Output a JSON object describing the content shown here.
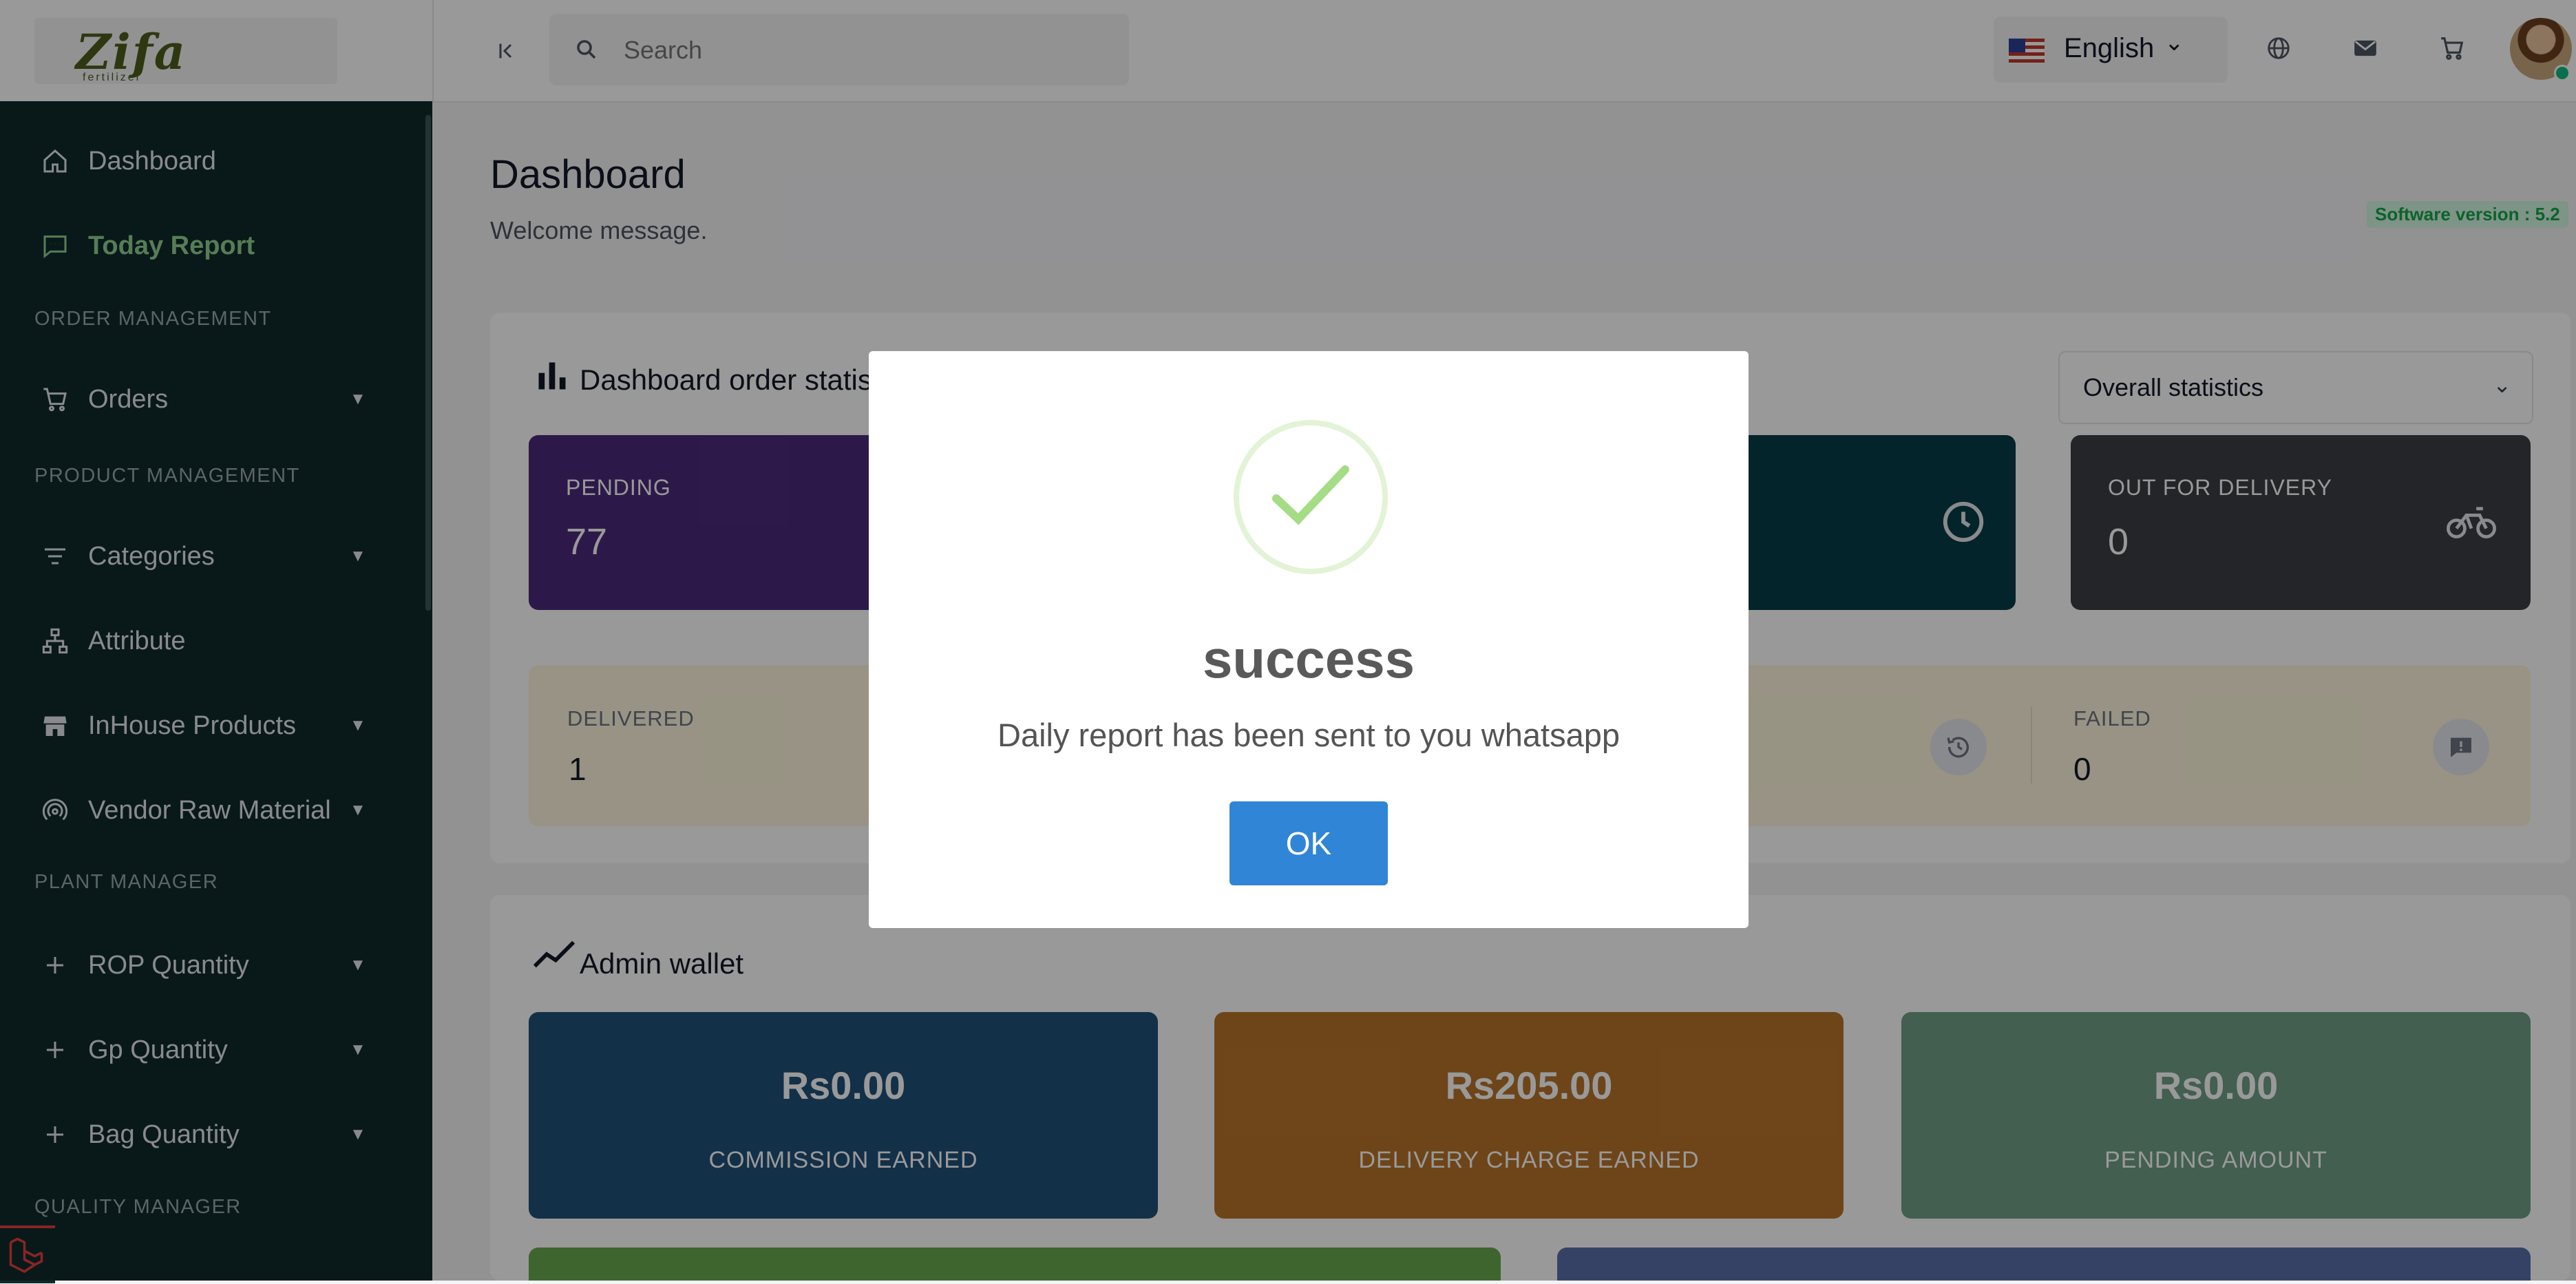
{
  "header": {
    "logo_text": "Zifa",
    "logo_sub": "fertilizer",
    "search_placeholder": "Search",
    "language": "English"
  },
  "sidebar": {
    "items": [
      {
        "label": "Dashboard"
      },
      {
        "label": "Today Report"
      }
    ],
    "sections": {
      "order": "ORDER MANAGEMENT",
      "product": "PRODUCT MANAGEMENT",
      "plant": "PLANT MANAGER",
      "quality": "QUALITY MANAGER"
    },
    "order_items": [
      {
        "label": "Orders"
      }
    ],
    "product_items": [
      {
        "label": "Categories"
      },
      {
        "label": "Attribute"
      },
      {
        "label": "InHouse Products"
      },
      {
        "label": "Vendor Raw Material"
      }
    ],
    "plant_items": [
      {
        "label": "ROP Quantity"
      },
      {
        "label": "Gp Quantity"
      },
      {
        "label": "Bag Quantity"
      }
    ]
  },
  "main": {
    "title": "Dashboard",
    "subtitle": "Welcome message.",
    "version": "Software version : 5.2",
    "order_stats": {
      "title": "Dashboard order statistics",
      "filter": "Overall statistics",
      "pending": {
        "label": "PENDING",
        "value": "77"
      },
      "out_for_delivery": {
        "label": "OUT FOR DELIVERY",
        "value": "0"
      },
      "delivered": {
        "label": "DELIVERED",
        "value": "1"
      },
      "failed": {
        "label": "FAILED",
        "value": "0"
      }
    },
    "wallet": {
      "title": "Admin wallet",
      "commission": {
        "amount": "Rs0.00",
        "label": "COMMISSION EARNED"
      },
      "delivery": {
        "amount": "Rs205.00",
        "label": "DELIVERY CHARGE EARNED"
      },
      "pending": {
        "amount": "Rs0.00",
        "label": "PENDING AMOUNT"
      }
    }
  },
  "modal": {
    "title": "success",
    "message": "Daily report has been sent to you whatsapp",
    "ok_label": "OK"
  },
  "colors": {
    "sidebar_bg": "#0f2a2c",
    "pending_card": "#4b2a7b",
    "processing_card": "#053c48",
    "out_for_delivery_card": "#3b3f45",
    "delivered_bg": "#fdf6dc",
    "wallet_commission": "#20507a",
    "wallet_delivery": "#b8742a",
    "wallet_pending": "#6f9e86",
    "ok_button": "#3085d6"
  }
}
